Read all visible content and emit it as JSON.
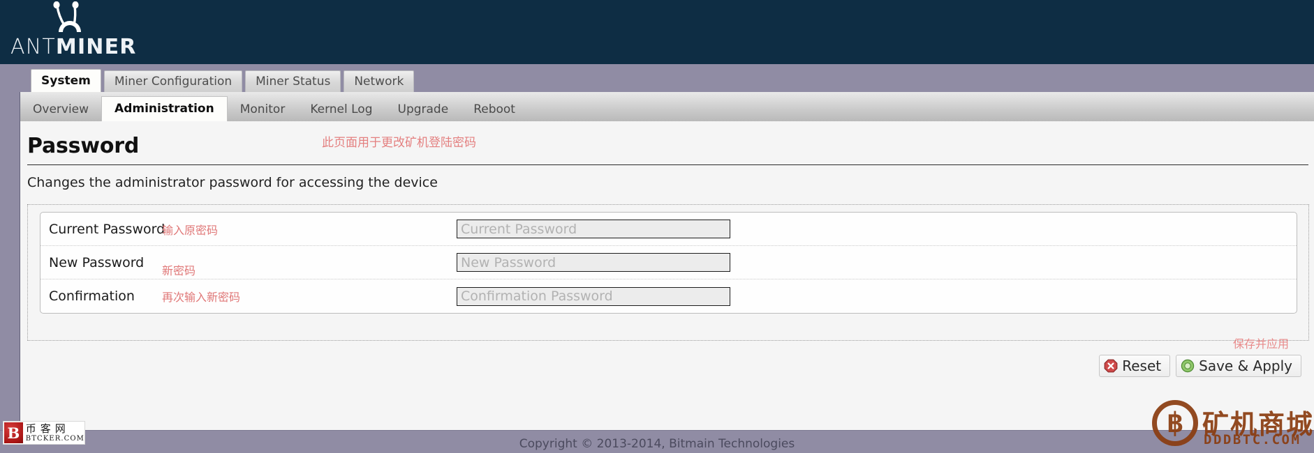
{
  "brand": {
    "logo_ant": "ANT",
    "logo_miner": "MINER",
    "logo_icon": "ant-antenna-icon"
  },
  "main_tabs": [
    {
      "label": "System",
      "active": true
    },
    {
      "label": "Miner Configuration",
      "active": false
    },
    {
      "label": "Miner Status",
      "active": false
    },
    {
      "label": "Network",
      "active": false
    }
  ],
  "sub_tabs": [
    {
      "label": "Overview",
      "active": false
    },
    {
      "label": "Administration",
      "active": true
    },
    {
      "label": "Monitor",
      "active": false
    },
    {
      "label": "Kernel Log",
      "active": false
    },
    {
      "label": "Upgrade",
      "active": false
    },
    {
      "label": "Reboot",
      "active": false
    }
  ],
  "page": {
    "title": "Password",
    "header_note": "此页面用于更改矿机登陆密码",
    "subtitle": "Changes the administrator password for accessing the device"
  },
  "form": {
    "rows": [
      {
        "label": "Current Password",
        "note": "输入原密码",
        "placeholder": "Current Password",
        "value": ""
      },
      {
        "label": "New Password",
        "note": "新密码",
        "placeholder": "New Password",
        "value": ""
      },
      {
        "label": "Confirmation",
        "note": "再次输入新密码",
        "placeholder": "Confirmation Password",
        "value": ""
      }
    ]
  },
  "actions": {
    "reset_label": "Reset",
    "save_label": "Save & Apply",
    "save_note": "保存并应用",
    "reset_icon": "red-octagon-x-icon",
    "save_icon": "green-disk-icon"
  },
  "footer": {
    "copyright": "Copyright © 2013-2014, Bitmain Technologies"
  },
  "watermarks": {
    "left": {
      "mark": "B",
      "cn": "币客网",
      "en": "BTCKER.COM"
    },
    "right": {
      "coin": "฿",
      "cn": "矿机商城",
      "en": "DDDBTC.COM"
    }
  },
  "colors": {
    "header_navy": "#0e2d44",
    "band_purple": "#908ca4",
    "annotation_red": "#e07878",
    "underline_red": "#e24646",
    "watermark_brown": "#8a3c10"
  }
}
